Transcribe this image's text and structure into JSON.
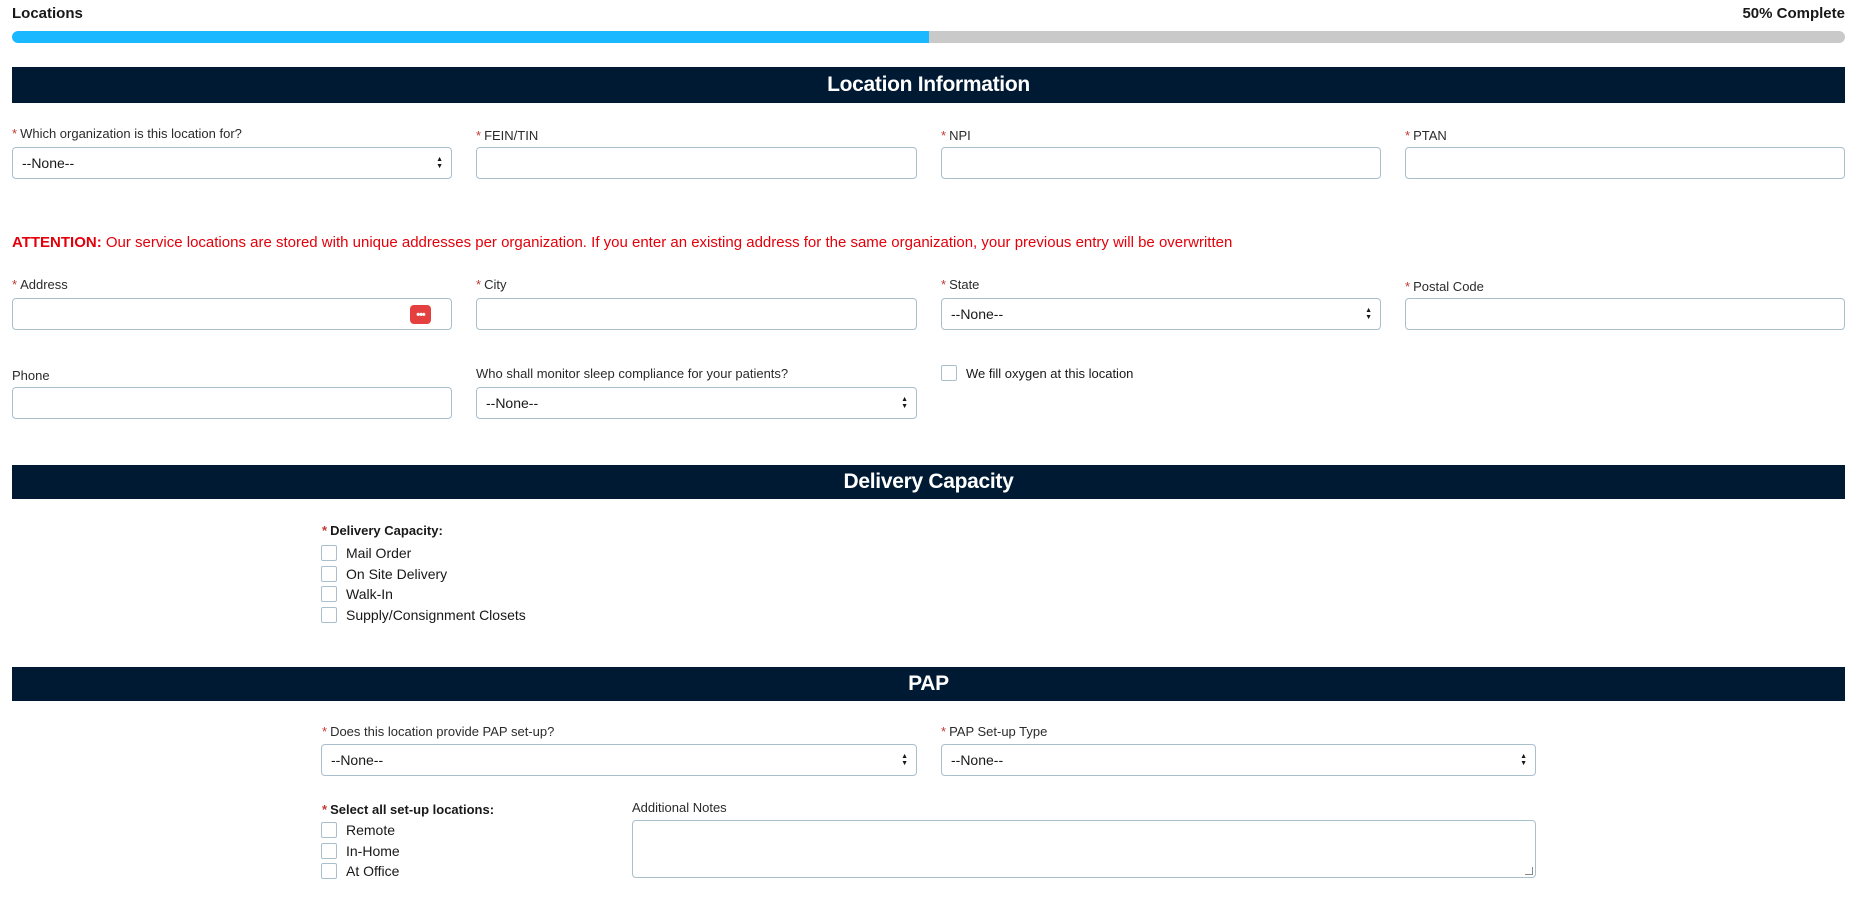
{
  "header": {
    "title": "Locations",
    "progress_text": "50% Complete",
    "progress_percent": 50,
    "progress_color": "#1ab9ff"
  },
  "sections": {
    "location_info": "Location Information",
    "delivery": "Delivery Capacity",
    "pap": "PAP"
  },
  "required_marker": "*",
  "location": {
    "organization_label": "Which organization is this location for?",
    "organization_value": "--None--",
    "fein_label": "FEIN/TIN",
    "npi_label": "NPI",
    "ptan_label": "PTAN",
    "attention_prefix": "ATTENTION:",
    "attention_text": " Our service locations are stored with unique addresses per organization. If you enter an existing address for the same organization, your previous entry will be overwritten",
    "address_label": "Address",
    "address_icon": "•••",
    "city_label": "City",
    "state_label": "State",
    "state_value": "--None--",
    "postal_label": "Postal Code",
    "phone_label": "Phone",
    "sleep_label": "Who shall monitor sleep compliance for your patients?",
    "sleep_value": "--None--",
    "oxygen_label": "We fill oxygen at this location"
  },
  "delivery": {
    "label": "Delivery Capacity:",
    "options": [
      "Mail Order",
      "On Site Delivery",
      "Walk-In",
      "Supply/Consignment Closets"
    ]
  },
  "pap": {
    "setup_label": "Does this location provide PAP set-up?",
    "setup_value": "--None--",
    "type_label": "PAP Set-up Type",
    "type_value": "--None--",
    "locations_label": "Select all set-up locations:",
    "locations": [
      "Remote",
      "In-Home",
      "At Office"
    ],
    "notes_label": "Additional Notes"
  }
}
